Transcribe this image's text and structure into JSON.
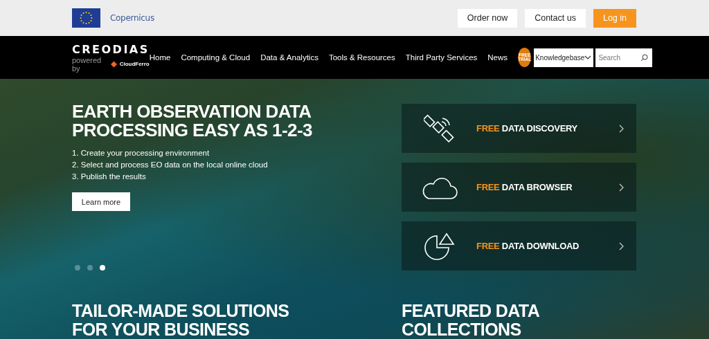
{
  "top_bar": {
    "partner_logo": "Copernicus",
    "buttons": [
      {
        "label": "Order now",
        "kind": "plain"
      },
      {
        "label": "Contact us",
        "kind": "plain"
      },
      {
        "label": "Log in",
        "kind": "accent"
      }
    ]
  },
  "nav": {
    "logo": {
      "name": "CREODIAS",
      "powered_by": "powered by",
      "partner": "CloudFerro"
    },
    "items": [
      "Home",
      "Computing & Cloud",
      "Data & Analytics",
      "Tools & Resources",
      "Third Party Services",
      "News"
    ],
    "badge": [
      "FREE",
      "TRIAL"
    ],
    "dropdown": "Knowledgebase",
    "search": {
      "placeholder": "Search"
    }
  },
  "hero": {
    "title": [
      "EARTH OBSERVATION DATA",
      "PROCESSING EASY AS 1-2-3"
    ],
    "steps": [
      "1. Create your processing environment",
      "2. Select and process EO data on the local online cloud",
      "3. Publish the results"
    ],
    "button": "Learn more",
    "slides": [
      {
        "selected": false
      },
      {
        "selected": false
      },
      {
        "selected": true
      }
    ],
    "cards": [
      {
        "kind": "satellite",
        "highlight": "FREE",
        "label": "DATA DISCOVERY"
      },
      {
        "kind": "cloud",
        "highlight": "FREE",
        "label": "DATA BROWSER"
      },
      {
        "kind": "pie",
        "highlight": "FREE",
        "label": "DATA DOWNLOAD"
      }
    ]
  },
  "sections": [
    [
      "TAILOR-MADE SOLUTIONS",
      "FOR YOUR BUSINESS"
    ],
    [
      "FEATURED DATA",
      "COLLECTIONS"
    ]
  ]
}
